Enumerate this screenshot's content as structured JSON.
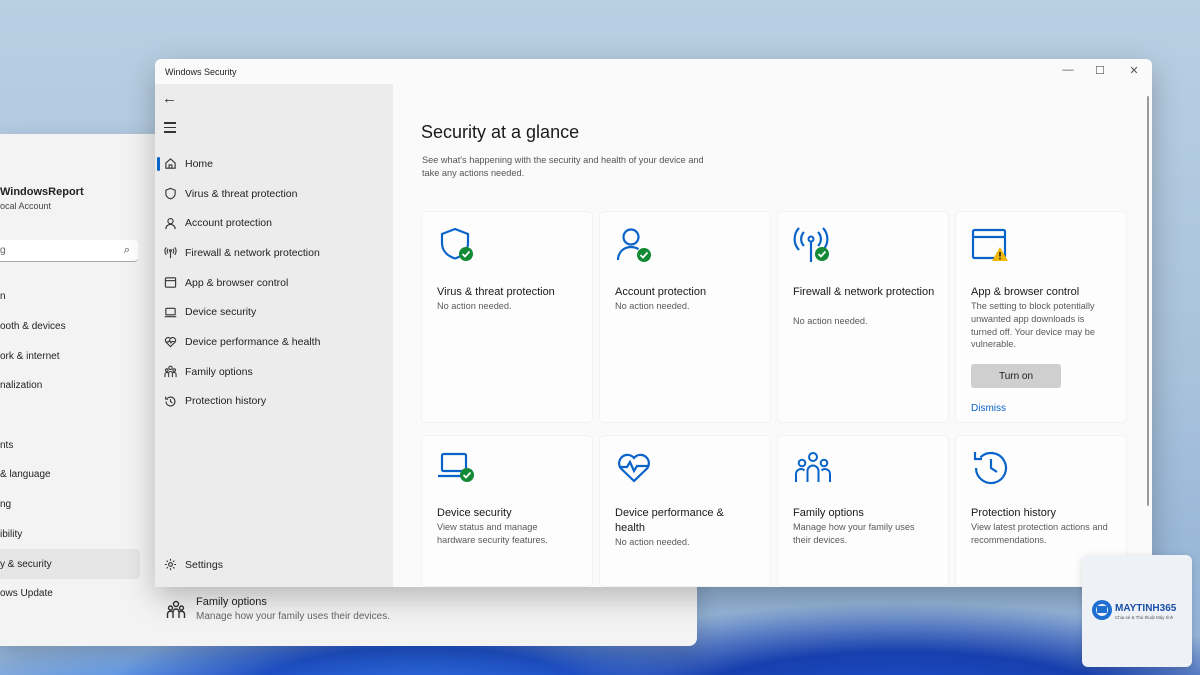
{
  "background_window": {
    "user": {
      "name": "WindowsReport",
      "account_type": "ocal Account"
    },
    "search_placeholder": "g",
    "nav": [
      {
        "label": "n"
      },
      {
        "label": "ooth & devices"
      },
      {
        "label": "ork & internet"
      },
      {
        "label": "nalization"
      },
      {
        "label": ""
      },
      {
        "label": "nts"
      },
      {
        "label": "& language"
      },
      {
        "label": "ng"
      },
      {
        "label": "ibility"
      },
      {
        "label": "y & security",
        "active": true
      },
      {
        "label": "ows Update"
      }
    ],
    "family": {
      "title": "Family options",
      "description": "Manage how your family uses their devices."
    }
  },
  "window": {
    "title": "Windows Security",
    "controls": {
      "minimize": "—",
      "maximize": "☐",
      "close": "✕"
    }
  },
  "sidebar": {
    "back_icon": "back-arrow-icon",
    "menu_icon": "hamburger-menu-icon",
    "items": [
      {
        "label": "Home",
        "icon": "home-icon",
        "active": true
      },
      {
        "label": "Virus & threat protection",
        "icon": "shield-icon"
      },
      {
        "label": "Account protection",
        "icon": "person-icon"
      },
      {
        "label": "Firewall & network protection",
        "icon": "antenna-icon"
      },
      {
        "label": "App & browser control",
        "icon": "browser-window-icon"
      },
      {
        "label": "Device security",
        "icon": "laptop-icon"
      },
      {
        "label": "Device performance & health",
        "icon": "heart-pulse-icon"
      },
      {
        "label": "Family options",
        "icon": "family-icon"
      },
      {
        "label": "Protection history",
        "icon": "history-icon"
      }
    ],
    "settings_label": "Settings"
  },
  "main": {
    "heading": "Security at a glance",
    "subheading": "See what's happening with the security and health of your device and take any actions needed.",
    "cards": [
      {
        "title": "Virus & threat protection",
        "status": "No action needed.",
        "icon": "shield-check-icon"
      },
      {
        "title": "Account protection",
        "status": "No action needed.",
        "icon": "person-check-icon"
      },
      {
        "title": "Firewall & network protection",
        "status": "No action needed.",
        "icon": "antenna-check-icon"
      },
      {
        "title": "App & browser control",
        "status": "The setting to block potentially unwanted app downloads is turned off. Your device may be vulnerable.",
        "icon": "browser-warning-icon",
        "button": "Turn on",
        "link": "Dismiss"
      },
      {
        "title": "Device security",
        "status": "View status and manage hardware security features.",
        "icon": "laptop-check-icon"
      },
      {
        "title": "Device performance & health",
        "status": "No action needed.",
        "icon": "heart-pulse-icon"
      },
      {
        "title": "Family options",
        "status": "Manage how your family uses their devices.",
        "icon": "family-icon"
      },
      {
        "title": "Protection history",
        "status": "View latest protection actions and recommendations.",
        "icon": "history-icon"
      }
    ]
  },
  "colors": {
    "accent": "#0a63c9",
    "ok_green": "#138a36",
    "warning": "#f2b705"
  },
  "watermark": {
    "brand": "MAYTINH365",
    "tagline": "Chia sẻ & Thủ thuật Máy tính"
  }
}
